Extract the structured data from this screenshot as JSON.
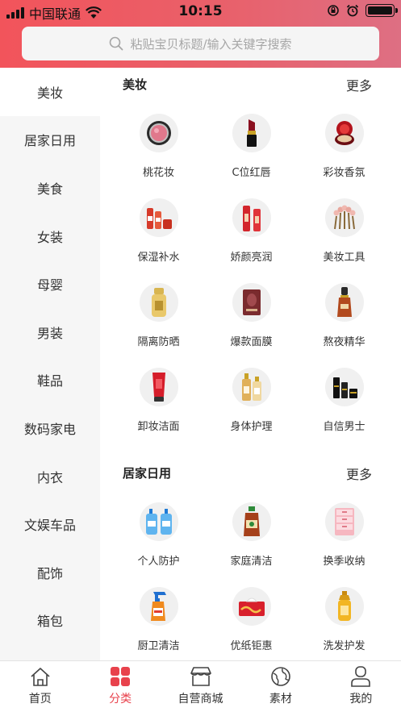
{
  "status_bar": {
    "carrier": "中国联通",
    "time": "10:15"
  },
  "search": {
    "placeholder": "粘贴宝贝标题/输入关键字搜索"
  },
  "sidebar": {
    "items": [
      {
        "label": "美妆"
      },
      {
        "label": "居家日用"
      },
      {
        "label": "美食"
      },
      {
        "label": "女装"
      },
      {
        "label": "母婴"
      },
      {
        "label": "男装"
      },
      {
        "label": "鞋品"
      },
      {
        "label": "数码家电"
      },
      {
        "label": "内衣"
      },
      {
        "label": "文娱车品"
      },
      {
        "label": "配饰"
      },
      {
        "label": "箱包"
      }
    ],
    "active_index": 0
  },
  "sections": [
    {
      "title": "美妆",
      "more_label": "更多",
      "items": [
        {
          "label": "桃花妆",
          "icon": "blush-compact-icon"
        },
        {
          "label": "C位红唇",
          "icon": "lipstick-icon"
        },
        {
          "label": "彩妆香氛",
          "icon": "cushion-compact-icon"
        },
        {
          "label": "保湿补水",
          "icon": "moisturizer-set-icon"
        },
        {
          "label": "娇颜亮润",
          "icon": "serum-bottles-icon"
        },
        {
          "label": "美妆工具",
          "icon": "makeup-brushes-icon"
        },
        {
          "label": "隔离防晒",
          "icon": "sunscreen-bottle-icon"
        },
        {
          "label": "爆款面膜",
          "icon": "face-mask-icon"
        },
        {
          "label": "熬夜精华",
          "icon": "essence-bottle-icon"
        },
        {
          "label": "卸妆洁面",
          "icon": "cleanser-tube-icon"
        },
        {
          "label": "身体护理",
          "icon": "body-lotion-icon"
        },
        {
          "label": "自信男士",
          "icon": "mens-skincare-icon"
        }
      ]
    },
    {
      "title": "居家日用",
      "more_label": "更多",
      "items": [
        {
          "label": "个人防护",
          "icon": "hand-sanitizer-icon"
        },
        {
          "label": "家庭清洁",
          "icon": "disinfectant-bottle-icon"
        },
        {
          "label": "换季收纳",
          "icon": "storage-drawers-icon"
        },
        {
          "label": "厨卫清洁",
          "icon": "spray-cleaner-icon"
        },
        {
          "label": "优纸钜惠",
          "icon": "tissue-box-icon"
        },
        {
          "label": "洗发护发",
          "icon": "shampoo-bottle-icon"
        }
      ]
    }
  ],
  "tabbar": {
    "items": [
      {
        "label": "首页",
        "icon": "home-icon"
      },
      {
        "label": "分类",
        "icon": "category-grid-icon"
      },
      {
        "label": "自营商城",
        "icon": "store-icon"
      },
      {
        "label": "素材",
        "icon": "materials-icon"
      },
      {
        "label": "我的",
        "icon": "profile-icon"
      }
    ],
    "active_index": 1
  },
  "colors": {
    "accent": "#e8424c",
    "header_start": "#f2545b",
    "header_end": "#de6f83",
    "sidebar_bg": "#f6f6f6"
  }
}
